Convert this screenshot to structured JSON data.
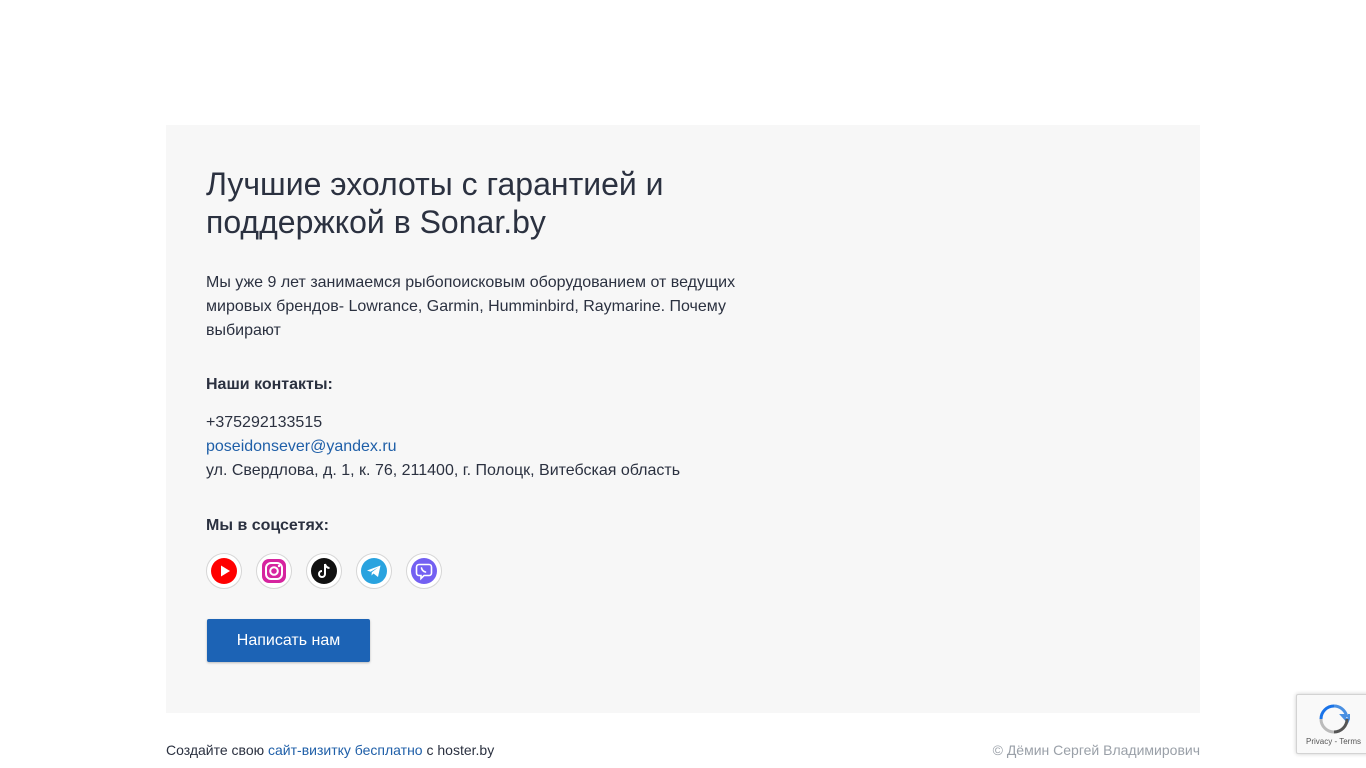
{
  "card": {
    "title": "Лучшие эхолоты с гарантией и поддержкой в Sonar.by",
    "description": "Мы уже 9 лет занимаемся  рыбопоисковым оборудованием от ведущих мировых брендов- Lowrance, Garmin, Humminbird, Raymarine. Почему выбирают",
    "contacts_heading": "Наши контакты:",
    "phone": "+375292133515",
    "email": "poseidonsever@yandex.ru",
    "address": "ул. Свердлова, д. 1, к. 76, 211400, г. Полоцк, Витебская область",
    "social_heading": "Мы в соцсетях:",
    "socials": [
      {
        "icon": "youtube-icon",
        "color": "#ff0000"
      },
      {
        "icon": "instagram-icon",
        "color": "#d6249f"
      },
      {
        "icon": "tiktok-icon",
        "color": "#111111"
      },
      {
        "icon": "telegram-icon",
        "color": "#2aa3df"
      },
      {
        "icon": "viber-icon",
        "color": "#7360f2"
      }
    ],
    "cta_label": "Написать нам"
  },
  "footer": {
    "left_prefix": "Создайте свою",
    "left_link": "сайт-визитку бесплатно",
    "left_suffix": "с hoster.by",
    "copyright": "© Дёмин Сергей Владимирович"
  },
  "recaptcha": {
    "links": "Privacy - Terms"
  },
  "colors": {
    "accent": "#1c63b5",
    "link": "#1f5fa8",
    "card_bg": "#f7f7f7"
  }
}
